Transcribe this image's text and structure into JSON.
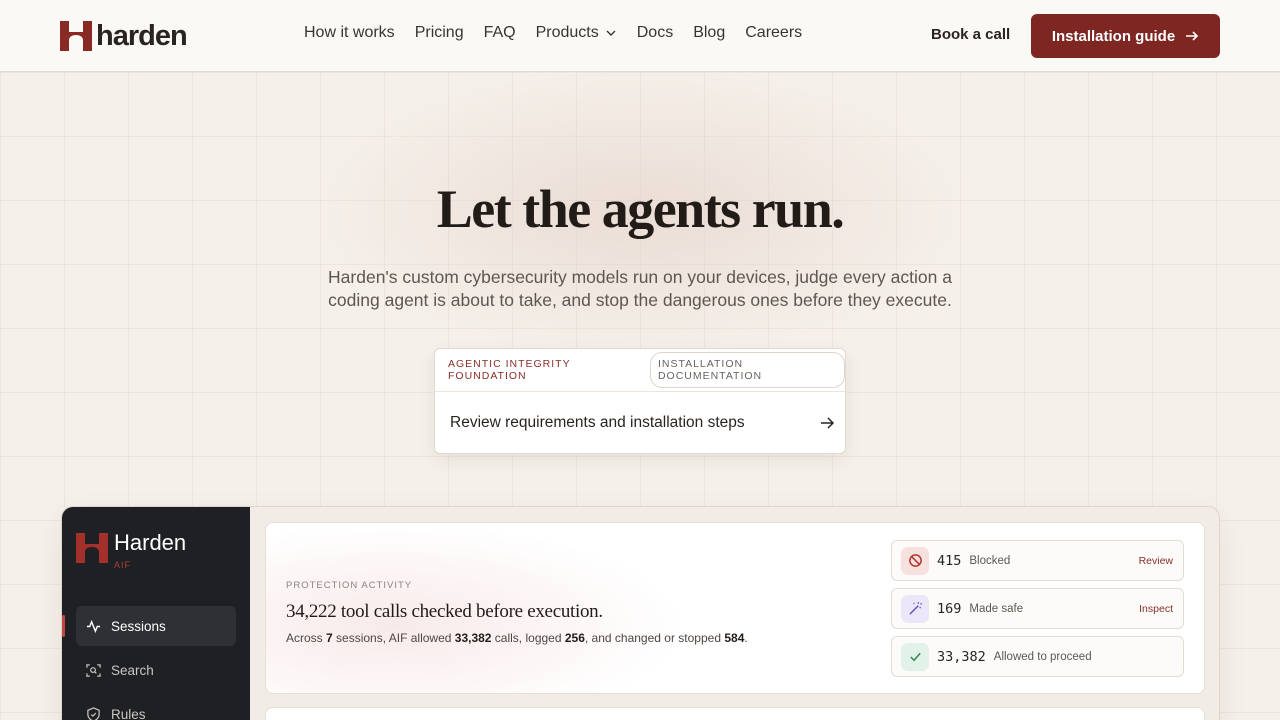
{
  "header": {
    "logo_text": "harden",
    "nav": [
      "How it works",
      "Pricing",
      "FAQ",
      "Products",
      "Docs",
      "Blog",
      "Careers"
    ],
    "book_label": "Book a call",
    "cta_label": "Installation guide"
  },
  "hero": {
    "title": "Let the agents run.",
    "subtitle": "Harden's custom cybersecurity models run on your devices, judge every action a coding agent is about to take, and stop the dangerous ones before they execute."
  },
  "install": {
    "tag": "AGENTIC INTEGRITY FOUNDATION",
    "pill": "INSTALLATION DOCUMENTATION",
    "link": "Review requirements and installation steps"
  },
  "app": {
    "brand": "Harden",
    "brand_sub": "AIF",
    "sidebar": [
      "Sessions",
      "Search",
      "Rules"
    ],
    "activity": {
      "label": "PROTECTION ACTIVITY",
      "title": "34,222 tool calls checked before execution.",
      "desc_prefix": "Across ",
      "sessions": "7",
      "desc_mid1": " sessions, AIF allowed ",
      "allowed": "33,382",
      "desc_mid2": " calls, logged ",
      "logged": "256",
      "desc_mid3": ", and changed or stopped ",
      "stopped": "584",
      "desc_end": "."
    },
    "stats": [
      {
        "num": "415",
        "label": "Blocked",
        "action": "Review",
        "icon": "ban-icon",
        "color": "#b3362c"
      },
      {
        "num": "169",
        "label": "Made safe",
        "action": "Inspect",
        "icon": "wand-icon",
        "color": "#6a55c9"
      },
      {
        "num": "33,382",
        "label": "Allowed to proceed",
        "action": "",
        "icon": "check-icon",
        "color": "#2e8a55"
      }
    ]
  }
}
